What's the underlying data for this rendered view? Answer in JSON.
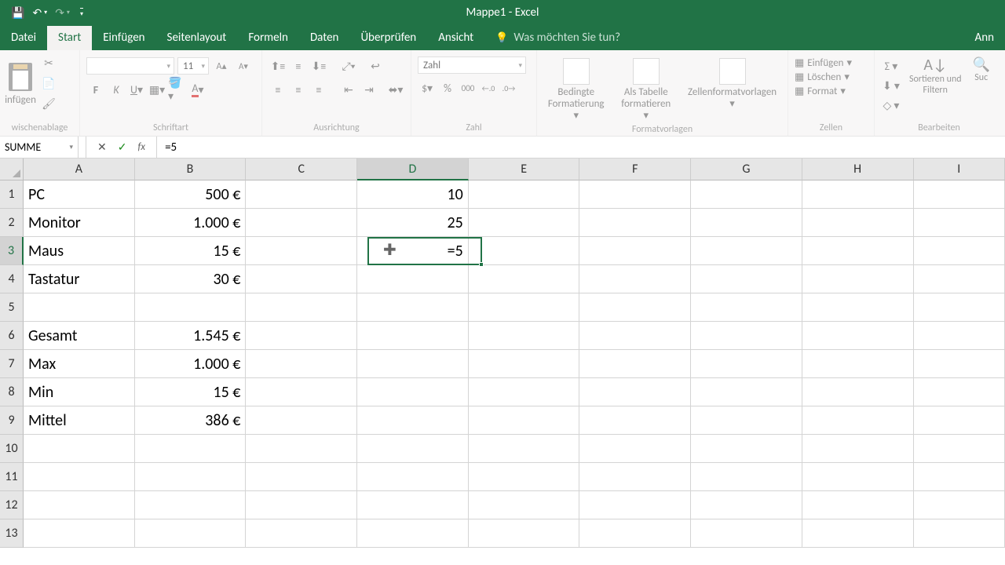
{
  "title": "Mappe1 - Excel",
  "tabs": {
    "file": "Datei",
    "home": "Start",
    "insert": "Einfügen",
    "pagelayout": "Seitenlayout",
    "formulas": "Formeln",
    "data": "Daten",
    "review": "Überprüfen",
    "view": "Ansicht",
    "tellme_placeholder": "Was möchten Sie tun?",
    "share": "Ann"
  },
  "ribbon": {
    "clipboard": {
      "paste": "infügen",
      "label": "wischenablage"
    },
    "font": {
      "size": "11",
      "label": "Schriftart"
    },
    "align": {
      "label": "Ausrichtung"
    },
    "number": {
      "format": "Zahl",
      "label": "Zahl"
    },
    "styles": {
      "cond": "Bedingte\nFormatierung",
      "table": "Als Tabelle\nformatieren",
      "cell": "Zellenformatvorlagen",
      "label": "Formatvorlagen"
    },
    "cells": {
      "insert": "Einfügen",
      "delete": "Löschen",
      "format": "Format",
      "label": "Zellen"
    },
    "editing": {
      "sort": "Sortieren und\nFiltern",
      "find": "Suc",
      "label": "Bearbeiten"
    }
  },
  "namebox": "SUMME",
  "formula": "=5",
  "colheads": [
    "A",
    "B",
    "C",
    "D",
    "E",
    "F",
    "G",
    "H",
    "I"
  ],
  "rows": {
    "1": {
      "A": "PC",
      "B": "500 €",
      "D": "10"
    },
    "2": {
      "A": "Monitor",
      "B": "1.000 €",
      "D": "25"
    },
    "3": {
      "A": "Maus",
      "B": "15 €",
      "D": "=5"
    },
    "4": {
      "A": "Tastatur",
      "B": "30 €"
    },
    "5": {},
    "6": {
      "A": "Gesamt",
      "B": "1.545 €"
    },
    "7": {
      "A": "Max",
      "B": "1.000 €"
    },
    "8": {
      "A": "Min",
      "B": "15 €"
    },
    "9": {
      "A": "Mittel",
      "B": "386 €"
    },
    "10": {},
    "11": {},
    "12": {},
    "13": {}
  },
  "active": {
    "col": "D",
    "row": 3
  }
}
